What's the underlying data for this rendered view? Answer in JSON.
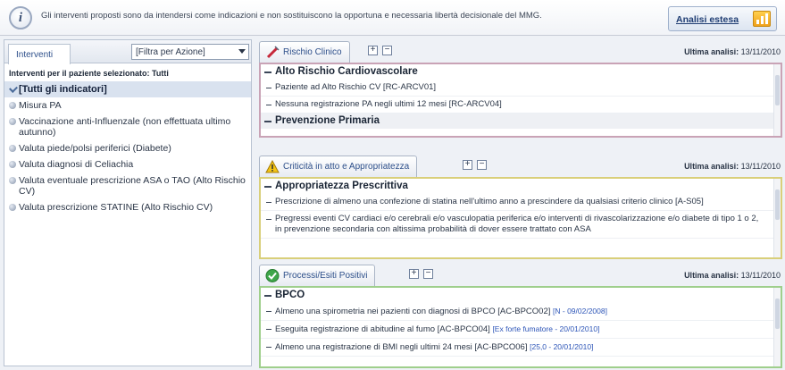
{
  "info_bar": {
    "text": "Gli interventi proposti sono da intendersi come indicazioni e non sostituiscono la opportuna e necessaria libertà decisionale del MMG.",
    "analisi_label": "Analisi estesa"
  },
  "left_panel": {
    "tab_label": "Interventi",
    "filter_value": "[Filtra per Azione]",
    "heading": "Interventi per il paziente selezionato: Tutti",
    "items": [
      {
        "label": "[Tutti gli indicatori]"
      },
      {
        "label": "Misura PA"
      },
      {
        "label": "Vaccinazione anti-Influenzale (non effettuata ultimo autunno)"
      },
      {
        "label": "Valuta piede/polsi periferici (Diabete)"
      },
      {
        "label": "Valuta diagnosi di Celiachia"
      },
      {
        "label": "Valuta eventuale prescrizione ASA o TAO (Alto Rischio CV)"
      },
      {
        "label": "Valuta prescrizione STATINE (Alto Rischio CV)"
      }
    ]
  },
  "sections": [
    {
      "tab_label": "Rischio Clinico",
      "ultima_label": "Ultima analisi:",
      "ultima_date": "13/11/2010",
      "border_color": "#c9a3b6",
      "groups": [
        {
          "title": "Alto Rischio Cardiovascolare",
          "rows": [
            {
              "text": "Paziente ad Alto Rischio CV [RC-ARCV01]",
              "note": ""
            },
            {
              "text": "Nessuna registrazione PA negli ultimi 12 mesi [RC-ARCV04]",
              "note": ""
            }
          ]
        },
        {
          "title": "Prevenzione Primaria",
          "rows": []
        }
      ]
    },
    {
      "tab_label": "Criticità in atto e Appropriatezza",
      "ultima_label": "Ultima analisi:",
      "ultima_date": "13/11/2010",
      "border_color": "#d9cf7a",
      "groups": [
        {
          "title": "Appropriatezza Prescrittiva",
          "rows": [
            {
              "text": "Prescrizione di almeno una confezione di statina nell'ultimo anno a prescindere da qualsiasi criterio clinico [A-S05]",
              "note": ""
            },
            {
              "text": "Pregressi eventi CV cardiaci e/o cerebrali e/o vasculopatia periferica e/o interventi di rivascolarizzazione e/o diabete di tipo 1 o 2, in prevenzione secondaria con altissima probabilità di dover essere trattato con ASA",
              "note": ""
            }
          ]
        }
      ]
    },
    {
      "tab_label": "Processi/Esiti Positivi",
      "ultima_label": "Ultima analisi:",
      "ultima_date": "13/11/2010",
      "border_color": "#9fcf8c",
      "groups": [
        {
          "title": "BPCO",
          "rows": [
            {
              "text": "Almeno una spirometria nei pazienti con diagnosi di BPCO [AC-BPCO02]",
              "note": "[N - 09/02/2008]"
            },
            {
              "text": "Eseguita registrazione di abitudine al fumo [AC-BPCO04]",
              "note": "[Ex forte fumatore - 20/01/2010]"
            },
            {
              "text": "Almeno una registrazione di BMI negli ultimi 24 mesi [AC-BPCO06]",
              "note": "[25,0 - 20/01/2010]"
            }
          ]
        }
      ]
    }
  ]
}
